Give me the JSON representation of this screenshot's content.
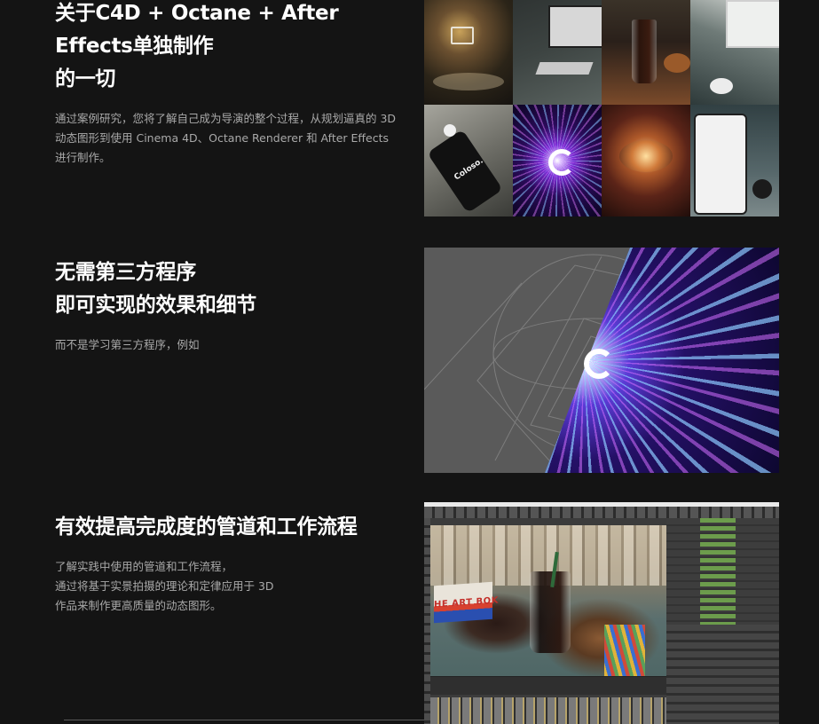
{
  "sections": [
    {
      "heading_lines": [
        "关于C4D + Octane + After",
        "Effects单独制作",
        "的一切"
      ],
      "description_lines": [
        "通过案例研究，您将了解自己成为导演的整个过程，从规划逼真的 3D",
        "动态图形到使用 Cinema 4D、Octane Renderer 和 After Effects",
        "进行制作。"
      ]
    },
    {
      "heading_lines": [
        "无需第三方程序",
        "即可实现的效果和细节"
      ],
      "description_lines": [
        "而不是学习第三方程序，例如"
      ]
    },
    {
      "heading_lines": [
        "有效提高完成度的管道和工作流程"
      ],
      "description_lines": [
        "了解实践中使用的管道和工作流程，",
        "通过将基于实景拍摄的理论和定律应用于 3D",
        "作品来制作更高质量的动态图形。"
      ]
    }
  ],
  "thumb_labels": {
    "phone_brand": "Coloso.",
    "artbook": "HE ART BOK"
  }
}
